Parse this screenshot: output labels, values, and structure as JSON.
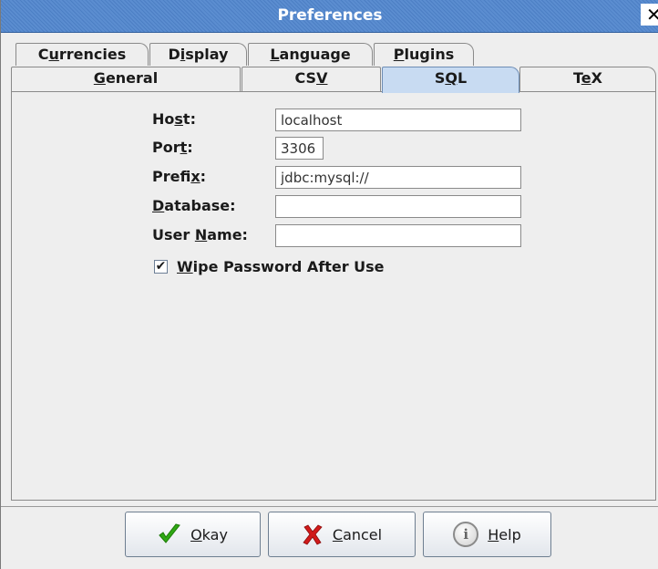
{
  "window": {
    "title": "Preferences",
    "close_glyph": "✕"
  },
  "tabs_row1": [
    {
      "pre": "C",
      "mn": "u",
      "post": "rrencies"
    },
    {
      "pre": "D",
      "mn": "i",
      "post": "splay"
    },
    {
      "pre": "",
      "mn": "L",
      "post": "anguage"
    },
    {
      "pre": "",
      "mn": "P",
      "post": "lugins"
    }
  ],
  "tabs_row2": [
    {
      "pre": "",
      "mn": "G",
      "post": "eneral"
    },
    {
      "pre": "CS",
      "mn": "V",
      "post": ""
    },
    {
      "pre": "S",
      "mn": "Q",
      "post": "L"
    },
    {
      "pre": "T",
      "mn": "e",
      "post": "X"
    }
  ],
  "selected_tab": "SQL",
  "form": {
    "host": {
      "pre": "Ho",
      "mn": "s",
      "post": "t:",
      "value": "localhost"
    },
    "port": {
      "pre": "Por",
      "mn": "t",
      "post": ":",
      "value": "3306"
    },
    "prefix": {
      "pre": "Prefi",
      "mn": "x",
      "post": ":",
      "value": "jdbc:mysql://"
    },
    "database": {
      "pre": "",
      "mn": "D",
      "post": "atabase:",
      "value": ""
    },
    "user_name": {
      "pre": "User ",
      "mn": "N",
      "post": "ame:",
      "value": ""
    },
    "wipe_password": {
      "pre": "",
      "mn": "W",
      "post": "ipe Password After Use",
      "checked": true,
      "check_glyph": "✔"
    }
  },
  "buttons": {
    "okay": {
      "pre": "",
      "mn": "O",
      "post": "kay",
      "icon": "check-icon"
    },
    "cancel": {
      "pre": "",
      "mn": "C",
      "post": "ancel",
      "icon": "x-icon"
    },
    "help": {
      "pre": "",
      "mn": "H",
      "post": "elp",
      "icon": "info-icon",
      "icon_glyph": "i"
    }
  },
  "colors": {
    "titlebar": "#4c7fc4",
    "selected_tab": "#c8dbf2",
    "ok_green": "#2fa814",
    "cancel_red": "#d11a1a"
  }
}
